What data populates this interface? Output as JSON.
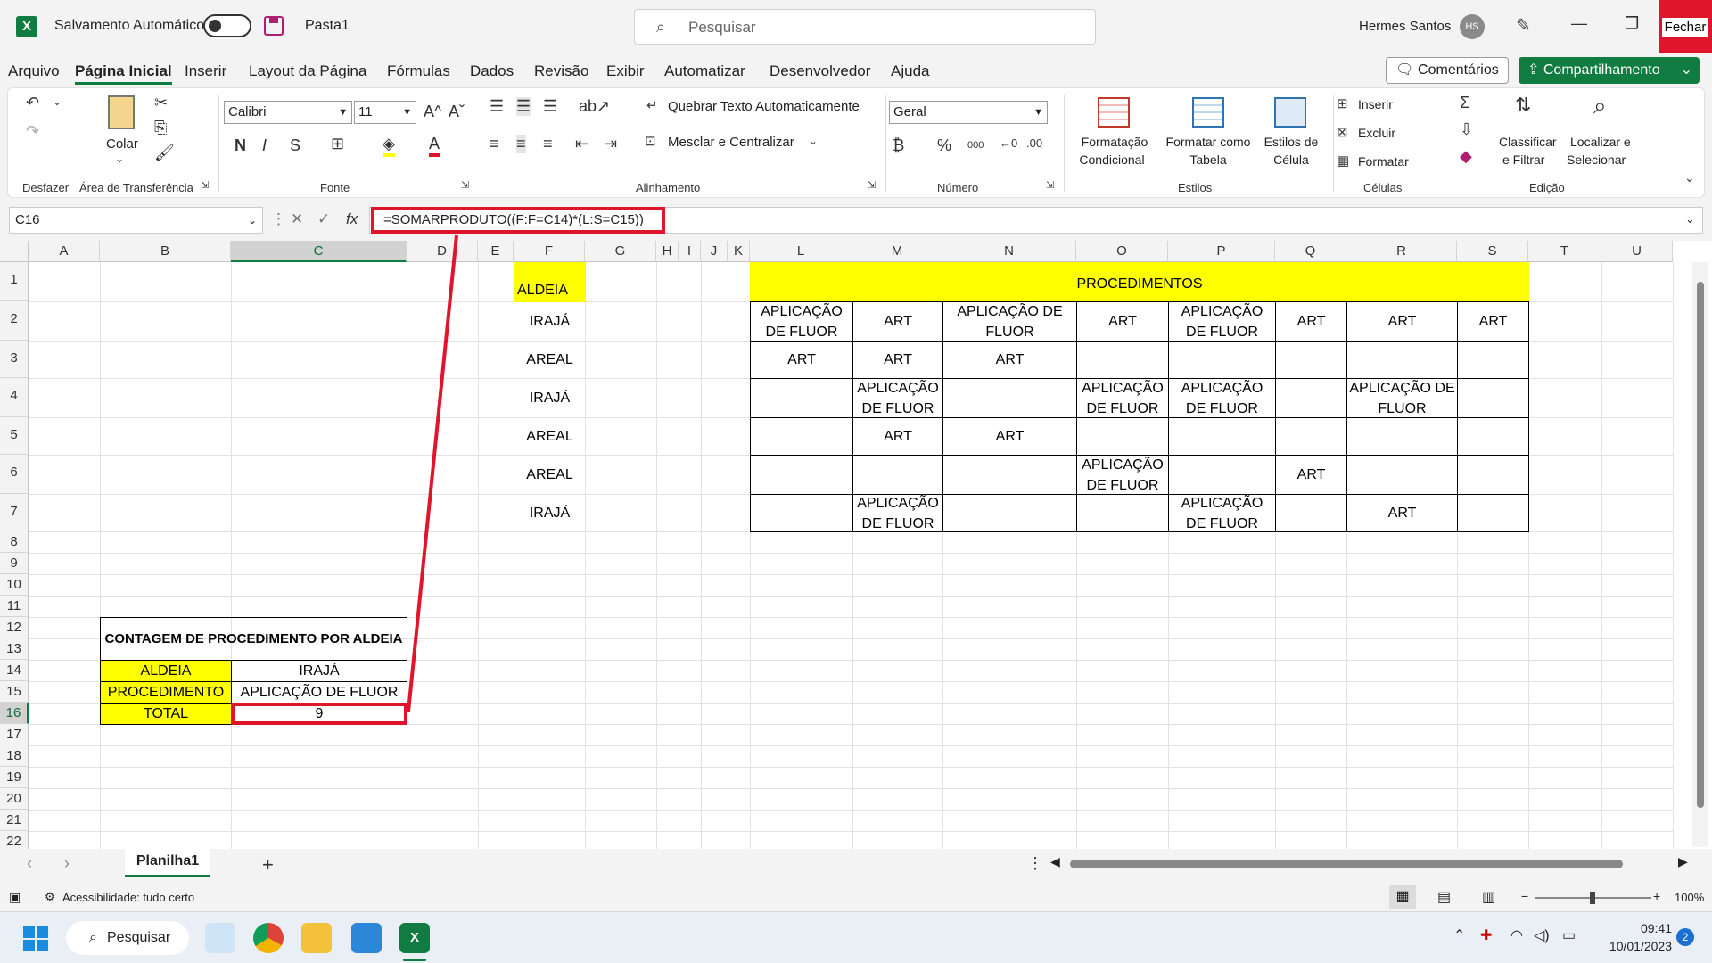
{
  "titlebar": {
    "app_icon_letter": "X",
    "autosave_label": "Salvamento Automático",
    "document_title": "Pasta1",
    "search_placeholder": "Pesquisar",
    "user_name": "Hermes Santos",
    "user_initials": "HS",
    "close_label": "Fechar"
  },
  "menu": {
    "items": [
      "Arquivo",
      "Página Inicial",
      "Inserir",
      "Layout da Página",
      "Fórmulas",
      "Dados",
      "Revisão",
      "Exibir",
      "Automatizar",
      "Desenvolvedor",
      "Ajuda"
    ],
    "active": "Página Inicial",
    "comments_label": "Comentários",
    "share_label": "Compartilhamento"
  },
  "ribbon": {
    "groups": {
      "undo": "Desfazer",
      "clipboard": "Área de Transferência",
      "font": "Fonte",
      "alignment": "Alinhamento",
      "number": "Número",
      "styles": "Estilos",
      "cells": "Células",
      "editing": "Edição"
    },
    "paste_label": "Colar",
    "font_name": "Calibri",
    "font_size": "11",
    "wrap_text": "Quebrar Texto Automaticamente",
    "merge_center": "Mesclar e Centralizar",
    "number_format": "Geral",
    "conditional_format": [
      "Formatação",
      "Condicional"
    ],
    "format_as_table": [
      "Formatar como",
      "Tabela"
    ],
    "cell_styles": [
      "Estilos de",
      "Célula"
    ],
    "insert": "Inserir",
    "delete": "Excluir",
    "format": "Formatar",
    "sort_filter": [
      "Classificar",
      "e Filtrar"
    ],
    "find_select": [
      "Localizar e",
      "Selecionar"
    ]
  },
  "formula_bar": {
    "name_box": "C16",
    "formula": "=SOMARPRODUTO((F:F=C14)*(L:S=C15))"
  },
  "sheet": {
    "column_headers": [
      "A",
      "B",
      "C",
      "D",
      "E",
      "F",
      "G",
      "H",
      "I",
      "J",
      "K",
      "L",
      "M",
      "N",
      "O",
      "P",
      "Q",
      "R",
      "S",
      "T",
      "U"
    ],
    "selected_column": "C",
    "row_headers": [
      "1",
      "2",
      "3",
      "4",
      "5",
      "6",
      "7",
      "8",
      "9",
      "10",
      "11",
      "12",
      "13",
      "14",
      "15",
      "16",
      "17",
      "18",
      "19",
      "20",
      "21",
      "22"
    ],
    "selected_row": "16",
    "aldeia_header": "ALDEIA",
    "aldeia_values": [
      "IRAJÁ",
      "AREAL",
      "IRAJÁ",
      "AREAL",
      "AREAL",
      "IRAJÁ"
    ],
    "procedimentos_header": "PROCEDIMENTOS",
    "procedimentos_rows": [
      [
        "APLICAÇÃO DE FLUOR",
        "ART",
        "APLICAÇÃO DE FLUOR",
        "ART",
        "APLICAÇÃO DE FLUOR",
        "ART",
        "ART",
        "ART"
      ],
      [
        "ART",
        "ART",
        "ART",
        "",
        "",
        "",
        "",
        ""
      ],
      [
        "",
        "APLICAÇÃO DE FLUOR",
        "",
        "APLICAÇÃO DE FLUOR",
        "APLICAÇÃO DE FLUOR",
        "",
        "APLICAÇÃO DE FLUOR",
        ""
      ],
      [
        "",
        "ART",
        "ART",
        "",
        "",
        "",
        "",
        ""
      ],
      [
        "",
        "",
        "",
        "APLICAÇÃO DE FLUOR",
        "",
        "ART",
        "",
        ""
      ],
      [
        "",
        "APLICAÇÃO DE FLUOR",
        "",
        "",
        "APLICAÇÃO DE FLUOR",
        "",
        "ART",
        ""
      ]
    ],
    "summary": {
      "title": "CONTAGEM DE PROCEDIMENTO POR ALDEIA",
      "aldeia_label": "ALDEIA",
      "aldeia_value": "IRAJÁ",
      "procedimento_label": "PROCEDIMENTO",
      "procedimento_value": "APLICAÇÃO DE FLUOR",
      "total_label": "TOTAL",
      "total_value": "9"
    }
  },
  "sheet_tabs": {
    "active": "Planilha1",
    "add": "+"
  },
  "status_bar": {
    "accessibility": "Acessibilidade: tudo certo",
    "zoom": "100%"
  },
  "taskbar": {
    "search_label": "Pesquisar",
    "time": "09:41",
    "date": "10/01/2023",
    "notification_count": "2"
  },
  "colors": {
    "excel_green": "#107c41",
    "highlight_yellow": "#ffff00",
    "annotation_red": "#e0142b"
  }
}
